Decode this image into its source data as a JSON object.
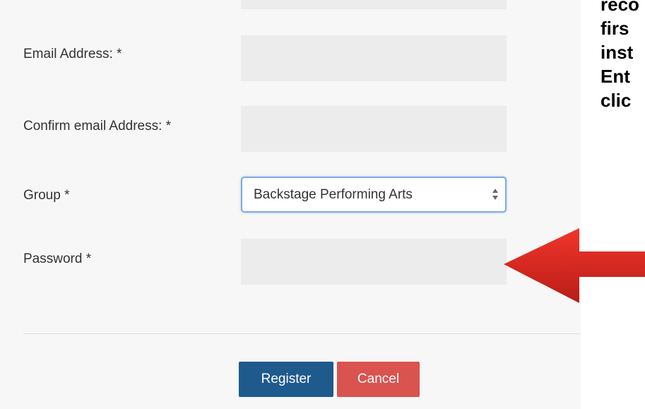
{
  "form": {
    "email_label": "Email Address: *",
    "confirm_email_label": "Confirm email Address: *",
    "group_label": "Group *",
    "group_value": "Backstage Performing Arts",
    "password_label": "Password *"
  },
  "buttons": {
    "register": "Register",
    "cancel": "Cancel"
  },
  "instructions": {
    "lines": [
      "reco",
      "firs",
      "inst",
      "Ent",
      "clic"
    ]
  },
  "colors": {
    "register_bg": "#1f5a8d",
    "cancel_bg": "#d9534f",
    "arrow": "#d42a22"
  }
}
